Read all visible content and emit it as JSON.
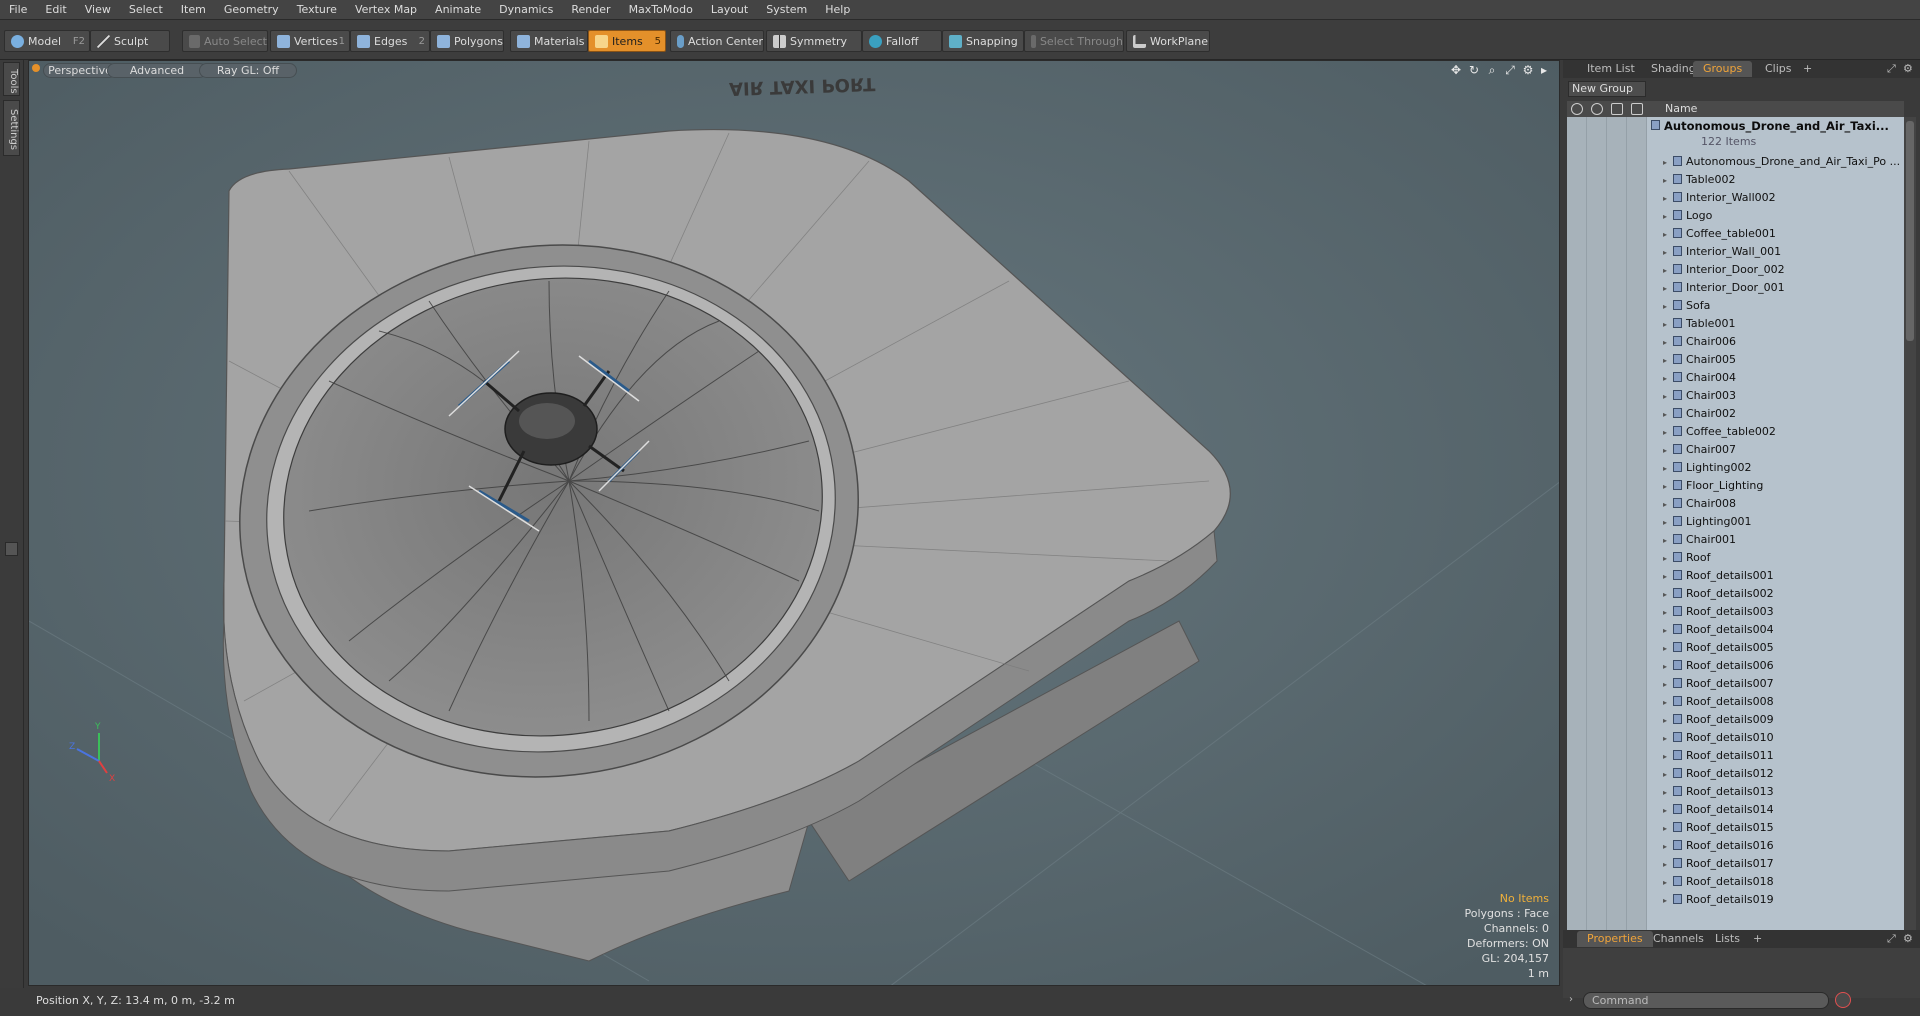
{
  "menubar": [
    "File",
    "Edit",
    "View",
    "Select",
    "Item",
    "Geometry",
    "Texture",
    "Vertex Map",
    "Animate",
    "Dynamics",
    "Render",
    "MaxToModo",
    "Layout",
    "System",
    "Help"
  ],
  "toolbar": {
    "model": "Model",
    "model_key": "F2",
    "sculpt": "Sculpt",
    "auto_select": "Auto Select",
    "vertices": "Vertices",
    "vertices_key": "1",
    "edges": "Edges",
    "edges_key": "2",
    "polygons": "Polygons",
    "materials": "Materials",
    "items": "Items",
    "items_key": "5",
    "action_center": "Action Center",
    "symmetry": "Symmetry",
    "falloff": "Falloff",
    "snapping": "Snapping",
    "select_through": "Select Through",
    "workplane": "WorkPlane",
    "accent": "#e4902a"
  },
  "leftstrip": {
    "tools": "Tools",
    "settings": "Settings"
  },
  "viewport": {
    "view_mode": "Perspective",
    "shading": "Advanced",
    "raygl": "Ray GL: Off",
    "info": {
      "selection": "No Items",
      "polygons": "Polygons : Face",
      "channels": "Channels: 0",
      "deformers": "Deformers: ON",
      "gl": "GL: 204,157",
      "scale": "1 m"
    },
    "nav_icons": [
      "move-view-icon",
      "rotate-view-icon",
      "zoom-view-icon",
      "maximize-icon",
      "settings-icon",
      "expand-icon"
    ]
  },
  "statusbar": {
    "position": "Position X, Y, Z:  13.4 m, 0 m, -3.2 m"
  },
  "panel": {
    "tabs": [
      "Item List",
      "Shading",
      "Groups",
      "Clips"
    ],
    "active_tab": "Groups",
    "new_group": "New Group",
    "column_name": "Name",
    "root_name": "Autonomous_Drone_and_Air_Taxi...",
    "root_count": "122 Items",
    "items": [
      "Autonomous_Drone_and_Air_Taxi_Po ...",
      "Table002",
      "Interior_Wall002",
      "Logo",
      "Coffee_table001",
      "Interior_Wall_001",
      "Interior_Door_002",
      "Interior_Door_001",
      "Sofa",
      "Table001",
      "Chair006",
      "Chair005",
      "Chair004",
      "Chair003",
      "Chair002",
      "Coffee_table002",
      "Chair007",
      "Lighting002",
      "Floor_Lighting",
      "Chair008",
      "Lighting001",
      "Chair001",
      "Roof",
      "Roof_details001",
      "Roof_details002",
      "Roof_details003",
      "Roof_details004",
      "Roof_details005",
      "Roof_details006",
      "Roof_details007",
      "Roof_details008",
      "Roof_details009",
      "Roof_details010",
      "Roof_details011",
      "Roof_details012",
      "Roof_details013",
      "Roof_details014",
      "Roof_details015",
      "Roof_details016",
      "Roof_details017",
      "Roof_details018",
      "Roof_details019"
    ],
    "bottom_tabs": [
      "Properties",
      "Channels",
      "Lists"
    ],
    "bottom_active": "Properties",
    "command_placeholder": "Command"
  }
}
